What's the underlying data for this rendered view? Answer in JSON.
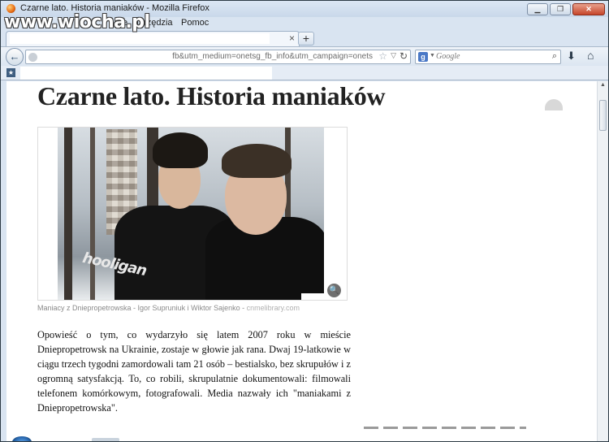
{
  "window": {
    "title": "Czarne lato. Historia maniaków - Mozilla Firefox",
    "controls": {
      "minimize": "▁",
      "maximize": "❐",
      "close": "✕"
    }
  },
  "watermark": "www.wiocha.pl",
  "menu": {
    "items": [
      "P",
      "e",
      "Narzędzia",
      "Pomoc"
    ]
  },
  "tabs": {
    "close_glyph": "×",
    "new_tab_glyph": "+"
  },
  "nav": {
    "back_glyph": "←",
    "url": "fb&utm_medium=onetsg_fb_info&utm_campaign=onets",
    "star_glyph": "☆",
    "dropdown_glyph": "▽",
    "reload_glyph": "↻",
    "search_engine": "g",
    "search_dropdown": "▼",
    "search_placeholder": "Google",
    "search_glyph": "⌕",
    "downloads_glyph": "⬇",
    "home_glyph": "⌂"
  },
  "bookmarks": {
    "icon": "★"
  },
  "article": {
    "headline": "Czarne lato. Historia maniaków",
    "photo_logo_text": "hooligan",
    "zoom_glyph": "🔍",
    "caption": "Maniacy z Dniepropetrowska - Igor Supruniuk i Wiktor Sajenko - ",
    "caption_source": "cnmelibrary.com",
    "body": "Opowieść o tym, co wydarzyło się latem 2007 roku w mieście Dniepropetrowsk na Ukrainie, zostaje w głowie jak rana. Dwaj 19-latkowie w ciągu trzech tygodni zamordowali tam 21 osób – bestialsko, bez skrupułów i z ogromną satysfakcją. To, co robili, skrupulatnie dokumentowali: filmowali telefonem komórkowym, fotografowali. Media nazwały ich \"maniakami z Dniepropetrowska\"."
  },
  "scrollbar": {
    "up_glyph": "▲"
  }
}
